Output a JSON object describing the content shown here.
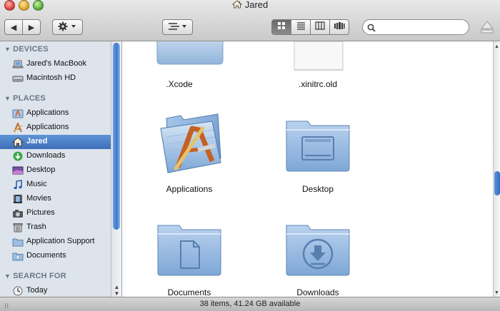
{
  "window": {
    "title": "Jared"
  },
  "toolbar": {
    "back": "◀",
    "forward": "▶",
    "action_icon": "gear-icon",
    "arrange_icon": "arrange-icon",
    "search": {
      "value": "",
      "placeholder": ""
    },
    "views": [
      "icon-view",
      "list-view",
      "column-view",
      "coverflow-view"
    ],
    "active_view": "icon-view"
  },
  "sidebar": {
    "sections": {
      "devices": "DEVICES",
      "places": "PLACES",
      "search_for": "SEARCH FOR"
    },
    "devices": [
      {
        "label": "Jared's MacBook",
        "icon": "laptop-icon"
      },
      {
        "label": "Macintosh HD",
        "icon": "harddisk-icon"
      }
    ],
    "places": [
      {
        "label": "Applications",
        "icon": "applications-icon"
      },
      {
        "label": "Applications",
        "icon": "applications-a-icon"
      },
      {
        "label": "Jared",
        "icon": "home-icon",
        "selected": true
      },
      {
        "label": "Downloads",
        "icon": "downloads-icon"
      },
      {
        "label": "Desktop",
        "icon": "desktop-icon"
      },
      {
        "label": "Music",
        "icon": "music-icon"
      },
      {
        "label": "Movies",
        "icon": "movies-icon"
      },
      {
        "label": "Pictures",
        "icon": "pictures-icon"
      },
      {
        "label": "Trash",
        "icon": "trash-icon"
      },
      {
        "label": "Application Support",
        "icon": "folder-icon"
      },
      {
        "label": "Documents",
        "icon": "documents-icon"
      }
    ],
    "search_for": [
      {
        "label": "Today",
        "icon": "clock-icon"
      }
    ]
  },
  "files": [
    {
      "name": ".Xcode",
      "kind": "folder"
    },
    {
      "name": ".xinitrc.old",
      "kind": "document"
    },
    {
      "name": "Applications",
      "kind": "applications-folder"
    },
    {
      "name": "Desktop",
      "kind": "desktop-folder"
    },
    {
      "name": "Documents",
      "kind": "documents-folder"
    },
    {
      "name": "Downloads",
      "kind": "downloads-folder"
    }
  ],
  "status": {
    "text": "38 items, 41.24 GB available"
  },
  "colors": {
    "selection": "#3d6fb9",
    "folder": "#8cb4dc",
    "sidebar_bg": "#dde4ec"
  }
}
